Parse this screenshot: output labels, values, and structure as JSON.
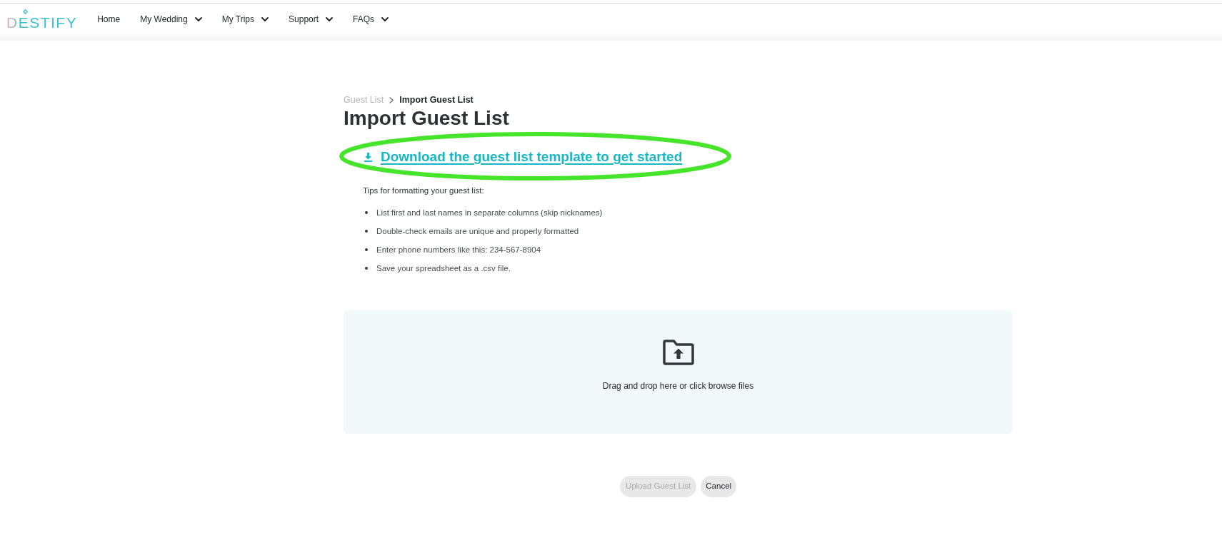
{
  "nav": {
    "logo": {
      "text": "DESTIFY"
    },
    "items": [
      {
        "label": "Home",
        "has_dropdown": false
      },
      {
        "label": "My Wedding",
        "has_dropdown": true
      },
      {
        "label": "My Trips",
        "has_dropdown": true
      },
      {
        "label": "Support",
        "has_dropdown": true
      },
      {
        "label": "FAQs",
        "has_dropdown": true
      }
    ]
  },
  "breadcrumb": [
    {
      "label": "Guest List",
      "current": false
    },
    {
      "label": "Import Guest List",
      "current": true
    }
  ],
  "page_title": "Import Guest List",
  "download_link": {
    "label": "Download the guest list template to get started",
    "highlighted": true
  },
  "tips": {
    "heading": "Tips for formatting your guest list:",
    "items": [
      "List first and last names in separate columns (skip nicknames)",
      "Double-check emails are unique and properly formatted",
      "Enter phone numbers like this: 234-567-8904",
      "Save your spreadsheet as a .csv file."
    ]
  },
  "drop_zone": {
    "instructions": "Drag and drop here or click browse files"
  },
  "buttons": [
    {
      "label": "Upload Guest List",
      "disabled": true
    },
    {
      "label": "Cancel",
      "disabled": false
    }
  ]
}
